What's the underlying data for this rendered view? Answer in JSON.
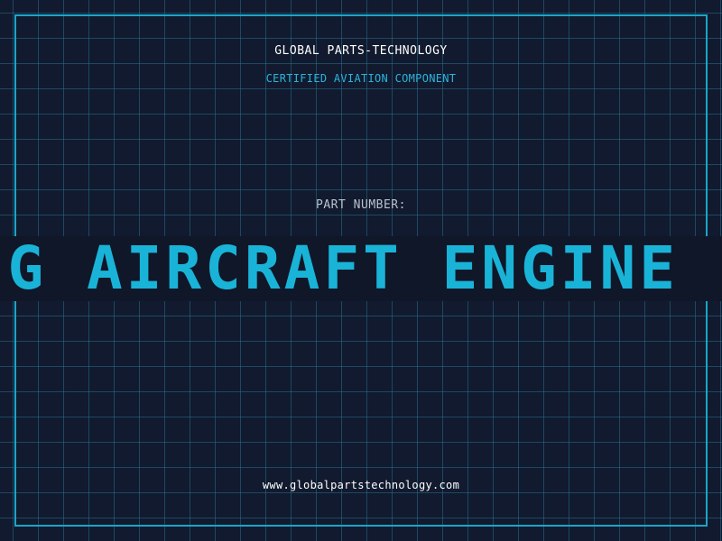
{
  "header": {
    "company": "GLOBAL PARTS-TECHNOLOGY",
    "subtitle": "CERTIFIED AVIATION COMPONENT"
  },
  "part": {
    "label": "PART NUMBER:",
    "value": "G AIRCRAFT ENGINE"
  },
  "footer": {
    "website": "www.globalpartstechnology.com"
  },
  "colors": {
    "background": "#111a2e",
    "grid": "#286e8c",
    "accent": "#1ab3d8",
    "frame": "#1aa6c9",
    "text_primary": "#ffffff",
    "text_muted": "#b9c2cc"
  }
}
